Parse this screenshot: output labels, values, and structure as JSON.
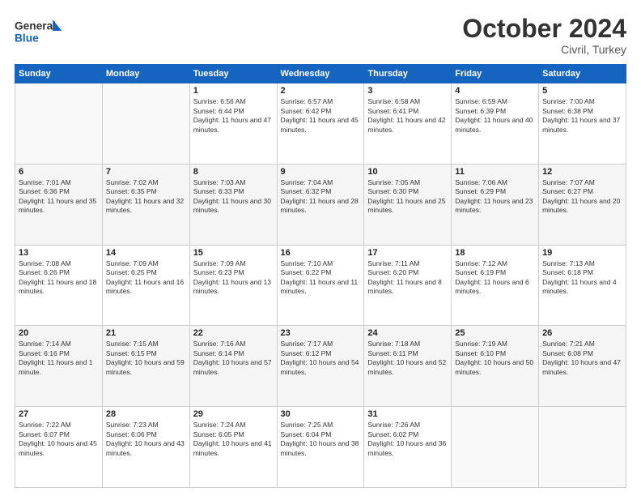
{
  "logo": {
    "line1": "General",
    "line2": "Blue"
  },
  "title": "October 2024",
  "location": "Civril, Turkey",
  "days_header": [
    "Sunday",
    "Monday",
    "Tuesday",
    "Wednesday",
    "Thursday",
    "Friday",
    "Saturday"
  ],
  "weeks": [
    [
      {
        "num": "",
        "info": ""
      },
      {
        "num": "",
        "info": ""
      },
      {
        "num": "1",
        "info": "Sunrise: 6:56 AM\nSunset: 6:44 PM\nDaylight: 11 hours and 47 minutes."
      },
      {
        "num": "2",
        "info": "Sunrise: 6:57 AM\nSunset: 6:42 PM\nDaylight: 11 hours and 45 minutes."
      },
      {
        "num": "3",
        "info": "Sunrise: 6:58 AM\nSunset: 6:41 PM\nDaylight: 11 hours and 42 minutes."
      },
      {
        "num": "4",
        "info": "Sunrise: 6:59 AM\nSunset: 6:39 PM\nDaylight: 11 hours and 40 minutes."
      },
      {
        "num": "5",
        "info": "Sunrise: 7:00 AM\nSunset: 6:38 PM\nDaylight: 11 hours and 37 minutes."
      }
    ],
    [
      {
        "num": "6",
        "info": "Sunrise: 7:01 AM\nSunset: 6:36 PM\nDaylight: 11 hours and 35 minutes."
      },
      {
        "num": "7",
        "info": "Sunrise: 7:02 AM\nSunset: 6:35 PM\nDaylight: 11 hours and 32 minutes."
      },
      {
        "num": "8",
        "info": "Sunrise: 7:03 AM\nSunset: 6:33 PM\nDaylight: 11 hours and 30 minutes."
      },
      {
        "num": "9",
        "info": "Sunrise: 7:04 AM\nSunset: 6:32 PM\nDaylight: 11 hours and 28 minutes."
      },
      {
        "num": "10",
        "info": "Sunrise: 7:05 AM\nSunset: 6:30 PM\nDaylight: 11 hours and 25 minutes."
      },
      {
        "num": "11",
        "info": "Sunrise: 7:06 AM\nSunset: 6:29 PM\nDaylight: 11 hours and 23 minutes."
      },
      {
        "num": "12",
        "info": "Sunrise: 7:07 AM\nSunset: 6:27 PM\nDaylight: 11 hours and 20 minutes."
      }
    ],
    [
      {
        "num": "13",
        "info": "Sunrise: 7:08 AM\nSunset: 6:26 PM\nDaylight: 11 hours and 18 minutes."
      },
      {
        "num": "14",
        "info": "Sunrise: 7:09 AM\nSunset: 6:25 PM\nDaylight: 11 hours and 16 minutes."
      },
      {
        "num": "15",
        "info": "Sunrise: 7:09 AM\nSunset: 6:23 PM\nDaylight: 11 hours and 13 minutes."
      },
      {
        "num": "16",
        "info": "Sunrise: 7:10 AM\nSunset: 6:22 PM\nDaylight: 11 hours and 11 minutes."
      },
      {
        "num": "17",
        "info": "Sunrise: 7:11 AM\nSunset: 6:20 PM\nDaylight: 11 hours and 8 minutes."
      },
      {
        "num": "18",
        "info": "Sunrise: 7:12 AM\nSunset: 6:19 PM\nDaylight: 11 hours and 6 minutes."
      },
      {
        "num": "19",
        "info": "Sunrise: 7:13 AM\nSunset: 6:18 PM\nDaylight: 11 hours and 4 minutes."
      }
    ],
    [
      {
        "num": "20",
        "info": "Sunrise: 7:14 AM\nSunset: 6:16 PM\nDaylight: 11 hours and 1 minute."
      },
      {
        "num": "21",
        "info": "Sunrise: 7:15 AM\nSunset: 6:15 PM\nDaylight: 10 hours and 59 minutes."
      },
      {
        "num": "22",
        "info": "Sunrise: 7:16 AM\nSunset: 6:14 PM\nDaylight: 10 hours and 57 minutes."
      },
      {
        "num": "23",
        "info": "Sunrise: 7:17 AM\nSunset: 6:12 PM\nDaylight: 10 hours and 54 minutes."
      },
      {
        "num": "24",
        "info": "Sunrise: 7:18 AM\nSunset: 6:11 PM\nDaylight: 10 hours and 52 minutes."
      },
      {
        "num": "25",
        "info": "Sunrise: 7:19 AM\nSunset: 6:10 PM\nDaylight: 10 hours and 50 minutes."
      },
      {
        "num": "26",
        "info": "Sunrise: 7:21 AM\nSunset: 6:08 PM\nDaylight: 10 hours and 47 minutes."
      }
    ],
    [
      {
        "num": "27",
        "info": "Sunrise: 7:22 AM\nSunset: 6:07 PM\nDaylight: 10 hours and 45 minutes."
      },
      {
        "num": "28",
        "info": "Sunrise: 7:23 AM\nSunset: 6:06 PM\nDaylight: 10 hours and 43 minutes."
      },
      {
        "num": "29",
        "info": "Sunrise: 7:24 AM\nSunset: 6:05 PM\nDaylight: 10 hours and 41 minutes."
      },
      {
        "num": "30",
        "info": "Sunrise: 7:25 AM\nSunset: 6:04 PM\nDaylight: 10 hours and 38 minutes."
      },
      {
        "num": "31",
        "info": "Sunrise: 7:26 AM\nSunset: 6:02 PM\nDaylight: 10 hours and 36 minutes."
      },
      {
        "num": "",
        "info": ""
      },
      {
        "num": "",
        "info": ""
      }
    ]
  ]
}
